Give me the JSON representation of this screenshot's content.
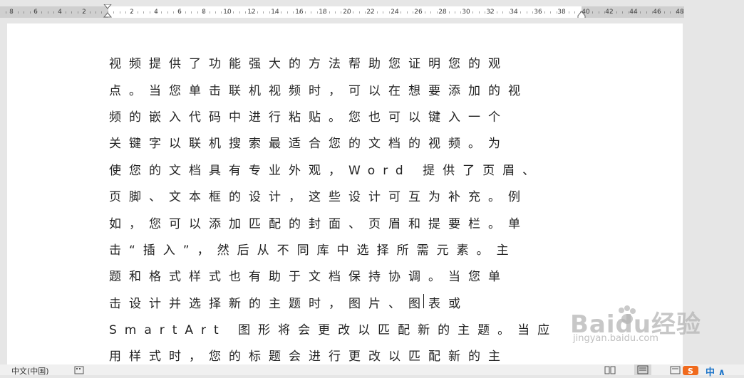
{
  "ruler": {
    "left_numbers": [
      "8",
      "6",
      "4",
      "2"
    ],
    "right_numbers": [
      "2",
      "4",
      "6",
      "8",
      "10",
      "12",
      "14",
      "16",
      "18",
      "20",
      "22",
      "24",
      "26",
      "28",
      "30",
      "32",
      "34",
      "36",
      "38",
      "40",
      "42",
      "44",
      "46",
      "48"
    ]
  },
  "document": {
    "lines": [
      "视频提供了功能强大的方法帮助您证明您的观",
      "点。当您单击联机视频时，可以在想要添加的视",
      "频的嵌入代码中进行粘贴。您也可以键入一个",
      "关键字以联机搜索最适合您的文档的视频。为",
      "使您的文档具有专业外观，Word 提供了页眉、",
      "页脚、文本框的设计，这些设计可互为补充。例",
      "如，您可以添加匹配的封面、页眉和提要栏。单",
      "击“插入”，然后从不同库中选择所需元素。主",
      "题和格式样式也有助于文档保持协调。当您单",
      "击设计并选择新的主题时，图片、图表或",
      "SmartArt 图形将会更改以匹配新的主题。当应",
      "用样式时，您的标题会进行更改以匹配新的主"
    ]
  },
  "watermark": {
    "logo": "Baidu经验",
    "url": "jingyan.baidu.com"
  },
  "statusbar": {
    "language": "中文(中国)",
    "corner_text": "中 ∧"
  }
}
